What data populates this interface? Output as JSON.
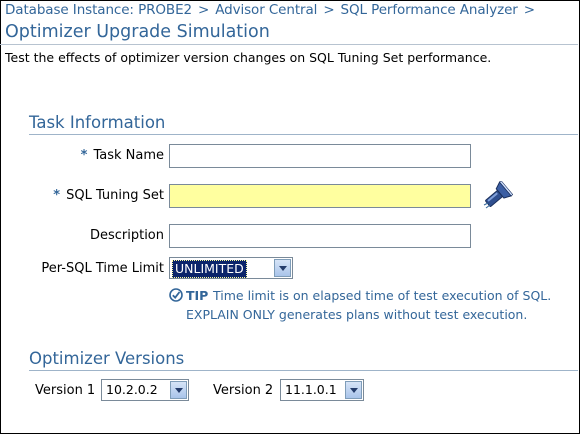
{
  "breadcrumb": {
    "items": [
      "Database Instance: PROBE2",
      "Advisor Central",
      "SQL Performance Analyzer"
    ],
    "separator": ">"
  },
  "page": {
    "title": "Optimizer Upgrade Simulation",
    "description": "Test the effects of optimizer version changes on SQL Tuning Set performance."
  },
  "task_information": {
    "header": "Task Information",
    "task_name": {
      "label": "Task Name",
      "required_marker": "*",
      "value": ""
    },
    "sql_tuning_set": {
      "label": "SQL Tuning Set",
      "required_marker": "*",
      "value": "",
      "search_icon": "flashlight-search-icon"
    },
    "description": {
      "label": "Description",
      "value": ""
    },
    "time_limit": {
      "label": "Per-SQL Time Limit",
      "selected": "UNLIMITED"
    },
    "tip": {
      "label": "TIP",
      "line1": "Time limit is on elapsed time of test execution of SQL.",
      "line2": "EXPLAIN ONLY generates plans without test execution."
    }
  },
  "optimizer_versions": {
    "header": "Optimizer Versions",
    "version1": {
      "label": "Version 1",
      "selected": "10.2.0.2"
    },
    "version2": {
      "label": "Version 2",
      "selected": "11.1.0.1"
    }
  },
  "colors": {
    "accent": "#336699",
    "highlight_field": "#ffff9f"
  }
}
